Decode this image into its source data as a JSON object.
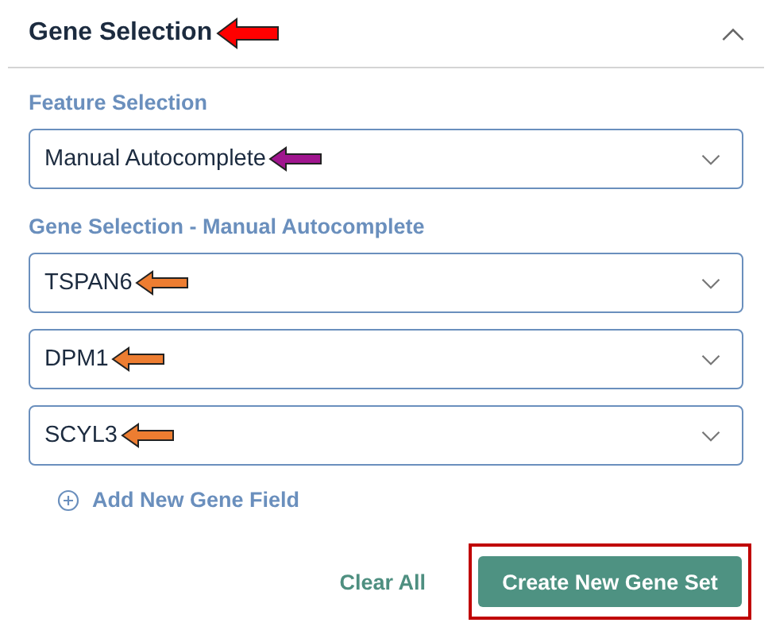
{
  "panel": {
    "title": "Gene Selection",
    "title_arrow": {
      "color": "#ff0000"
    },
    "expanded": true
  },
  "feature_selection": {
    "label": "Feature Selection",
    "value": "Manual Autocomplete",
    "arrow": {
      "color": "#a0158e"
    }
  },
  "gene_selection": {
    "label": "Gene Selection - Manual Autocomplete",
    "fields": [
      {
        "value": "TSPAN6",
        "arrow": {
          "color": "#ed7d31"
        }
      },
      {
        "value": "DPM1",
        "arrow": {
          "color": "#ed7d31"
        }
      },
      {
        "value": "SCYL3",
        "arrow": {
          "color": "#ed7d31"
        }
      }
    ]
  },
  "add_field": {
    "label": "Add New Gene Field"
  },
  "actions": {
    "clear": "Clear All",
    "create": "Create New Gene Set",
    "create_highlighted": true
  }
}
